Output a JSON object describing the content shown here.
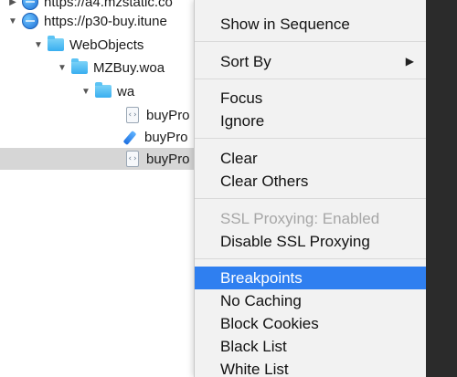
{
  "tree": {
    "rows": [
      {
        "label": "https://a4.mzstatic.co",
        "icon": "globe-icon",
        "disclosure": "▶"
      },
      {
        "label": "https://p30-buy.itune",
        "icon": "globe-icon",
        "disclosure": "▼"
      },
      {
        "label": "WebObjects",
        "icon": "folder-icon",
        "disclosure": "▼"
      },
      {
        "label": "MZBuy.woa",
        "icon": "folder-icon",
        "disclosure": "▼"
      },
      {
        "label": "wa",
        "icon": "folder-icon",
        "disclosure": "▼"
      },
      {
        "label": "buyPro",
        "icon": "document-icon"
      },
      {
        "label": "buyPro",
        "icon": "edit-pen-icon"
      },
      {
        "label": "buyPro",
        "icon": "document-icon"
      }
    ]
  },
  "menu": {
    "items": [
      {
        "label": "Show in Sequence"
      },
      {
        "label": "Sort By",
        "submenu": "▶"
      },
      {
        "label": "Focus"
      },
      {
        "label": "Ignore"
      },
      {
        "label": "Clear"
      },
      {
        "label": "Clear Others"
      },
      {
        "label": "SSL Proxying: Enabled",
        "disabled": true
      },
      {
        "label": "Disable SSL Proxying"
      },
      {
        "label": "Breakpoints",
        "highlighted": true
      },
      {
        "label": "No Caching"
      },
      {
        "label": "Block Cookies"
      },
      {
        "label": "Black List"
      },
      {
        "label": "White List"
      }
    ],
    "highlight_color": "#2f7ff0"
  },
  "glyphs": {
    "doc_glyph": "‹›"
  }
}
